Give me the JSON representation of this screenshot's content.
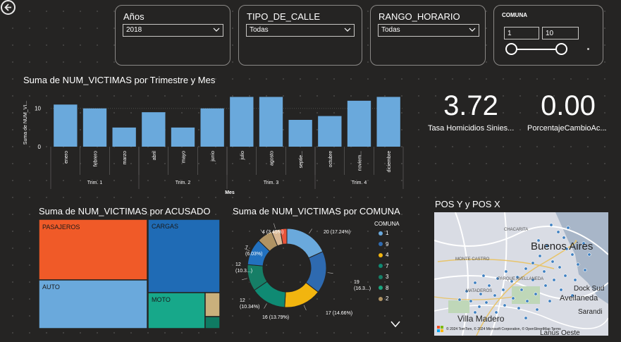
{
  "filters": {
    "anios": {
      "title": "Años",
      "value": "2018"
    },
    "tipo_calle": {
      "title": "TIPO_DE_CALLE",
      "value": "Todas"
    },
    "rango_horario": {
      "title": "RANGO_HORARIO",
      "value": "Todas"
    },
    "comuna": {
      "title": "COMUNA",
      "min": "1",
      "max": "10"
    }
  },
  "bar_title": "Suma de NUM_VICTIMAS por Trimestre y Mes",
  "cards": [
    {
      "value": "3.72",
      "label": "Tasa Homicidios Sinies..."
    },
    {
      "value": "0.00",
      "label": "PorcentajeCambioAc..."
    }
  ],
  "treemap": {
    "title": "Suma de NUM_VICTIMAS por ACUSADO",
    "labels": [
      "PASAJEROS",
      "CARGAS",
      "AUTO",
      "MOTO"
    ]
  },
  "donut_title": "Suma de NUM_VICTIMAS por COMUNA",
  "legend": {
    "title": "COMUNA",
    "items": [
      {
        "label": "1",
        "color": "#6aa9dc"
      },
      {
        "label": "9",
        "color": "#2e6ab0"
      },
      {
        "label": "4",
        "color": "#f2b50f"
      },
      {
        "label": "7",
        "color": "#0f8a73"
      },
      {
        "label": "3",
        "color": "#167e66"
      },
      {
        "label": "8",
        "color": "#1aa57e"
      },
      {
        "label": "2",
        "color": "#b09363"
      }
    ]
  },
  "map": {
    "title": "POS Y y POS X",
    "places": [
      "Buenos Aires",
      "Dock Sud",
      "Avellaneda",
      "Sarandi",
      "Villa Madero",
      "Lanús Oeste",
      "CHACARITA",
      "MONTE CASTRO",
      "MATADEROS",
      "PARQUE AVELLANEDA"
    ],
    "attribution": "© 2024 TomTom, © 2024 Microsoft Corporation, © OpenStreetMap  Terms"
  },
  "chart_data": [
    {
      "type": "bar",
      "title": "Suma de NUM_VICTIMAS por Trimestre y Mes",
      "xlabel": "Mes",
      "ylabel": "Suma de NUM_VI...",
      "categories": [
        "enero",
        "febrero",
        "marzo",
        "abril",
        "mayo",
        "junio",
        "julio",
        "agosto",
        "septie...",
        "octubre",
        "noviem...",
        "diciembre"
      ],
      "quarters": [
        "Trim. 1",
        "Trim. 2",
        "Trim. 3",
        "Trim. 4"
      ],
      "values": [
        11,
        10,
        5,
        9,
        5,
        10,
        13,
        13,
        7,
        8,
        12,
        13
      ],
      "yticks": [
        "0",
        "10"
      ],
      "ylim": [
        0,
        14
      ],
      "color": "#6aa9dc"
    },
    {
      "type": "treemap",
      "title": "Suma de NUM_VICTIMAS por ACUSADO",
      "labels": [
        "PASAJEROS",
        "AUTO",
        "CARGAS",
        "MOTO",
        "",
        ""
      ],
      "colors": [
        "#f05a28",
        "#6aa9dc",
        "#1f6bb5",
        "#17a88a",
        "#c9b07c",
        "#0f7a62"
      ]
    },
    {
      "type": "pie",
      "title": "Suma de NUM_VICTIMAS por COMUNA",
      "categories": [
        "1",
        "9",
        "4",
        "7",
        "3",
        "8",
        "2",
        "",
        ""
      ],
      "values": [
        20,
        19,
        17,
        16,
        12,
        12,
        7,
        4,
        3
      ],
      "data_labels": [
        "20 (17.24%)",
        "19 (16.3...)",
        "17 (14.66%)",
        "16 (13.79%)",
        "12 (10.34%)",
        "12 (10.3...)",
        "7 (6.03%)",
        "4 (3.45%)",
        ""
      ],
      "colors": [
        "#6aa9dc",
        "#2e6ab0",
        "#f2b50f",
        "#0f8a73",
        "#167e66",
        "#2271bf",
        "#b09363",
        "#d9b894",
        "#e8543a"
      ]
    }
  ]
}
